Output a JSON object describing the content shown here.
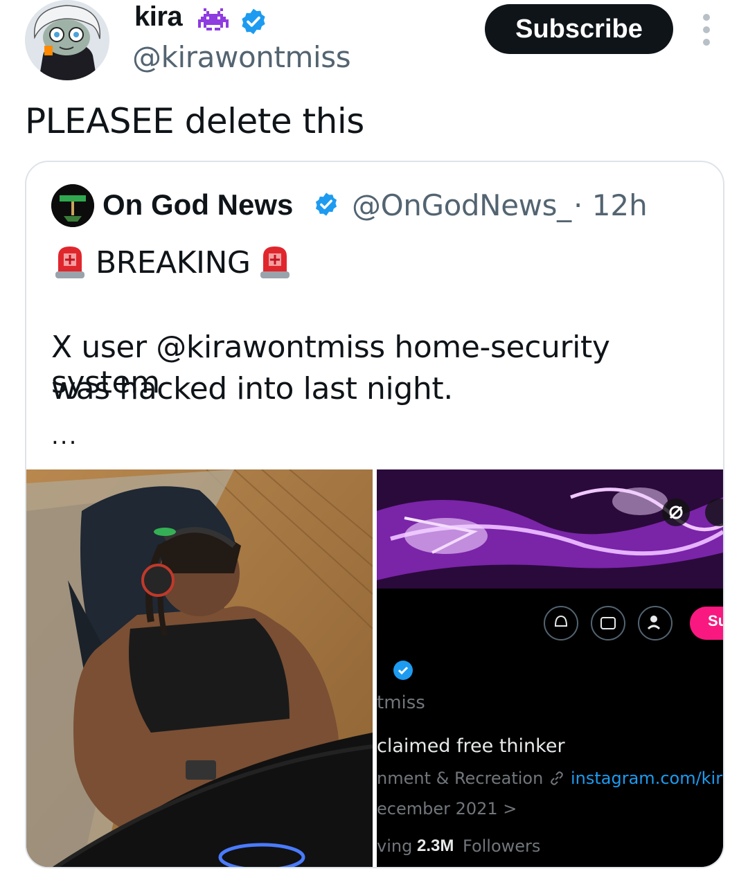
{
  "header": {
    "display_name": "kira",
    "handle": "@kirawontmiss",
    "subscribe_label": "Subscribe"
  },
  "tweet": {
    "text": "PLEASEE delete this"
  },
  "quote": {
    "name": "On God News",
    "handle": "@OnGodNews_",
    "time": "· 12h",
    "breaking": "BREAKING",
    "body_line1": "X user @kirawontmiss home-security system",
    "body_line2": "was hacked into last night.",
    "ellipsis": "...",
    "profile": {
      "handle_fragment": "tmiss",
      "bio": "claimed free thinker",
      "category": "nment & Recreation",
      "link": "instagram.com/kira",
      "joined": "ecember 2021 >",
      "following_fragment": "ving",
      "followers_count": "2.3M",
      "followers_label": "Followers",
      "subscribe_fragment": "Su"
    }
  },
  "colors": {
    "verified_blue": "#1d9bf0",
    "button_dark": "#0f1419",
    "muted_text": "#536471",
    "pink_subscribe": "#f91880"
  }
}
